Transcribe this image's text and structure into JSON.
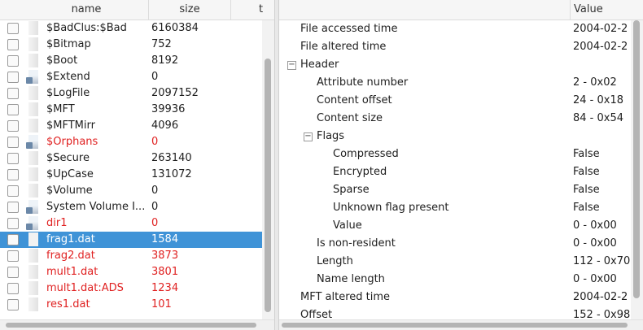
{
  "file_list": {
    "columns": {
      "name": "name",
      "size": "size",
      "type": "t"
    },
    "rows": [
      {
        "name": "$BadClus:$Bad",
        "size": "6160384",
        "kind": "file",
        "deleted": false,
        "selected": false
      },
      {
        "name": "$Bitmap",
        "size": "752",
        "kind": "file",
        "deleted": false,
        "selected": false
      },
      {
        "name": "$Boot",
        "size": "8192",
        "kind": "file",
        "deleted": false,
        "selected": false
      },
      {
        "name": "$Extend",
        "size": "0",
        "kind": "dir",
        "deleted": false,
        "selected": false
      },
      {
        "name": "$LogFile",
        "size": "2097152",
        "kind": "file",
        "deleted": false,
        "selected": false
      },
      {
        "name": "$MFT",
        "size": "39936",
        "kind": "file",
        "deleted": false,
        "selected": false
      },
      {
        "name": "$MFTMirr",
        "size": "4096",
        "kind": "file",
        "deleted": false,
        "selected": false
      },
      {
        "name": "$Orphans",
        "size": "0",
        "kind": "dir",
        "deleted": true,
        "selected": false
      },
      {
        "name": "$Secure",
        "size": "263140",
        "kind": "file",
        "deleted": false,
        "selected": false
      },
      {
        "name": "$UpCase",
        "size": "131072",
        "kind": "file",
        "deleted": false,
        "selected": false
      },
      {
        "name": "$Volume",
        "size": "0",
        "kind": "file",
        "deleted": false,
        "selected": false
      },
      {
        "name": "System Volume I...",
        "size": "0",
        "kind": "dir",
        "deleted": false,
        "selected": false
      },
      {
        "name": "dir1",
        "size": "0",
        "kind": "dir",
        "deleted": true,
        "selected": false
      },
      {
        "name": "frag1.dat",
        "size": "1584",
        "kind": "file",
        "deleted": false,
        "selected": true
      },
      {
        "name": "frag2.dat",
        "size": "3873",
        "kind": "file",
        "deleted": true,
        "selected": false
      },
      {
        "name": "mult1.dat",
        "size": "3801",
        "kind": "file",
        "deleted": true,
        "selected": false
      },
      {
        "name": "mult1.dat:ADS",
        "size": "1234",
        "kind": "file",
        "deleted": true,
        "selected": false
      },
      {
        "name": "res1.dat",
        "size": "101",
        "kind": "file",
        "deleted": true,
        "selected": false
      }
    ]
  },
  "properties": {
    "columns": {
      "value": "Value"
    },
    "rows": [
      {
        "label": "File accessed time",
        "value": "2004-02-2",
        "indent": 0,
        "expander": ""
      },
      {
        "label": "File altered time",
        "value": "2004-02-2",
        "indent": 0,
        "expander": ""
      },
      {
        "label": "Header",
        "value": "",
        "indent": 0,
        "expander": "−"
      },
      {
        "label": "Attribute number",
        "value": "2 - 0x02",
        "indent": 1,
        "expander": ""
      },
      {
        "label": "Content offset",
        "value": "24 - 0x18",
        "indent": 1,
        "expander": ""
      },
      {
        "label": "Content size",
        "value": "84 - 0x54",
        "indent": 1,
        "expander": ""
      },
      {
        "label": "Flags",
        "value": "",
        "indent": 1,
        "expander": "−"
      },
      {
        "label": "Compressed",
        "value": "False",
        "indent": 2,
        "expander": ""
      },
      {
        "label": "Encrypted",
        "value": "False",
        "indent": 2,
        "expander": ""
      },
      {
        "label": "Sparse",
        "value": "False",
        "indent": 2,
        "expander": ""
      },
      {
        "label": "Unknown flag present",
        "value": "False",
        "indent": 2,
        "expander": ""
      },
      {
        "label": "Value",
        "value": "0 - 0x00",
        "indent": 2,
        "expander": ""
      },
      {
        "label": "Is non-resident",
        "value": "0 - 0x00",
        "indent": 1,
        "expander": ""
      },
      {
        "label": "Length",
        "value": "112 - 0x70",
        "indent": 1,
        "expander": ""
      },
      {
        "label": "Name length",
        "value": "0 - 0x00",
        "indent": 1,
        "expander": ""
      },
      {
        "label": "MFT altered time",
        "value": "2004-02-2",
        "indent": 0,
        "expander": ""
      },
      {
        "label": "Offset",
        "value": "152 - 0x98",
        "indent": 0,
        "expander": ""
      }
    ]
  },
  "colors": {
    "selection": "#3f93d7",
    "deleted_text": "#e02222",
    "header_bg": "#f6f6f6"
  }
}
